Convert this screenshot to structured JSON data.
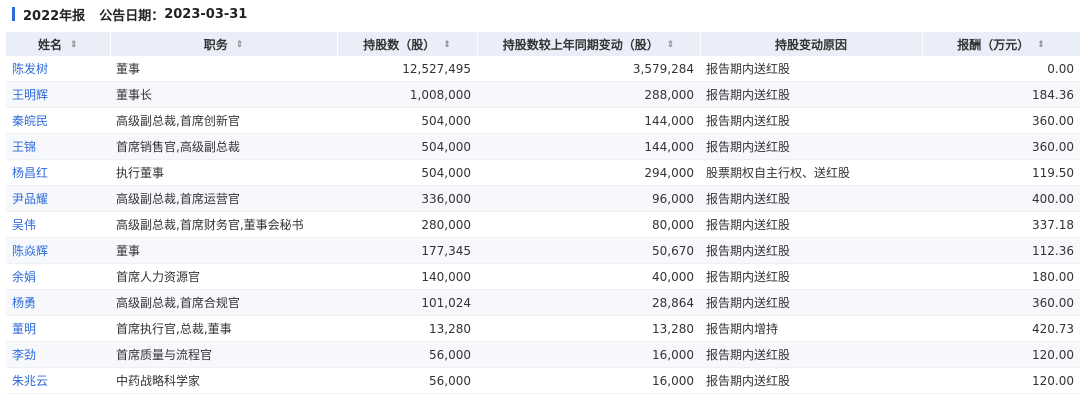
{
  "header": {
    "report_title": "2022年报",
    "announce_label": "公告日期：",
    "announce_date": "2023-03-31"
  },
  "table": {
    "columns": [
      {
        "label": "姓名",
        "sortable": true
      },
      {
        "label": "职务",
        "sortable": true
      },
      {
        "label": "持股数（股）",
        "sortable": true
      },
      {
        "label": "持股数较上年同期变动（股）",
        "sortable": true
      },
      {
        "label": "持股变动原因",
        "sortable": false
      },
      {
        "label": "报酬（万元）",
        "sortable": true
      }
    ],
    "sort_glyph": "⇕",
    "rows": [
      {
        "name": "陈发树",
        "title": "董事",
        "shares": "12,527,495",
        "change": "3,579,284",
        "reason": "报告期内送红股",
        "pay": "0.00"
      },
      {
        "name": "王明辉",
        "title": "董事长",
        "shares": "1,008,000",
        "change": "288,000",
        "reason": "报告期内送红股",
        "pay": "184.36"
      },
      {
        "name": "秦皖民",
        "title": "高级副总裁,首席创新官",
        "shares": "504,000",
        "change": "144,000",
        "reason": "报告期内送红股",
        "pay": "360.00"
      },
      {
        "name": "王锦",
        "title": "首席销售官,高级副总裁",
        "shares": "504,000",
        "change": "144,000",
        "reason": "报告期内送红股",
        "pay": "360.00"
      },
      {
        "name": "杨昌红",
        "title": "执行董事",
        "shares": "504,000",
        "change": "294,000",
        "reason": "股票期权自主行权、送红股",
        "pay": "119.50"
      },
      {
        "name": "尹品耀",
        "title": "高级副总裁,首席运营官",
        "shares": "336,000",
        "change": "96,000",
        "reason": "报告期内送红股",
        "pay": "400.00"
      },
      {
        "name": "吴伟",
        "title": "高级副总裁,首席财务官,董事会秘书",
        "shares": "280,000",
        "change": "80,000",
        "reason": "报告期内送红股",
        "pay": "337.18"
      },
      {
        "name": "陈焱辉",
        "title": "董事",
        "shares": "177,345",
        "change": "50,670",
        "reason": "报告期内送红股",
        "pay": "112.36"
      },
      {
        "name": "余娟",
        "title": "首席人力资源官",
        "shares": "140,000",
        "change": "40,000",
        "reason": "报告期内送红股",
        "pay": "180.00"
      },
      {
        "name": "杨勇",
        "title": "高级副总裁,首席合规官",
        "shares": "101,024",
        "change": "28,864",
        "reason": "报告期内送红股",
        "pay": "360.00"
      },
      {
        "name": "董明",
        "title": "首席执行官,总裁,董事",
        "shares": "13,280",
        "change": "13,280",
        "reason": "报告期内增持",
        "pay": "420.73"
      },
      {
        "name": "李劲",
        "title": "首席质量与流程官",
        "shares": "56,000",
        "change": "16,000",
        "reason": "报告期内送红股",
        "pay": "120.00"
      },
      {
        "name": "朱兆云",
        "title": "中药战略科学家",
        "shares": "56,000",
        "change": "16,000",
        "reason": "报告期内送红股",
        "pay": "120.00"
      }
    ]
  },
  "colors": {
    "accent": "#2f6bd8",
    "header_bg": "#e9eef8",
    "stripe_bg": "#f6f8fc"
  }
}
